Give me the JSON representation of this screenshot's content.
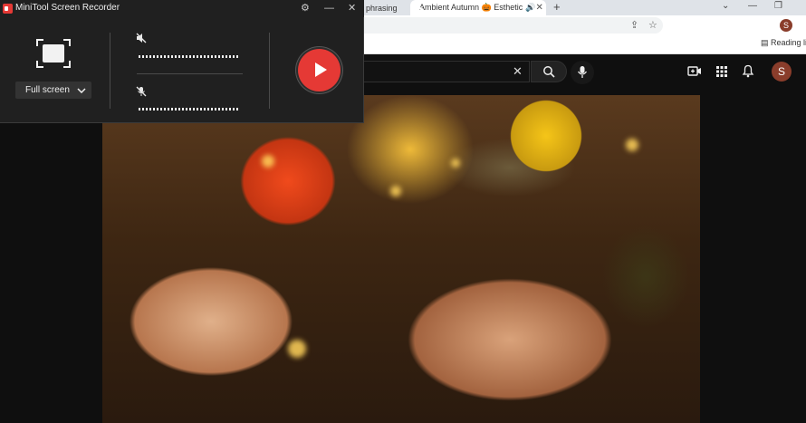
{
  "browser": {
    "tabs": [
      {
        "label": "phrasing"
      },
      {
        "label": "Ambient Autumn 🎃 Esthetic"
      }
    ],
    "new_tab": "+",
    "window_controls": {
      "minimize": "—",
      "restore": "❐",
      "close": "✕"
    },
    "bookmarks": {
      "reading_list": "Reading list"
    },
    "profile_initial": "S"
  },
  "youtube": {
    "search_clear": "✕",
    "avatar_initial": "S"
  },
  "recorder": {
    "title": "MiniTool Screen Recorder",
    "capture_mode": "Full screen",
    "controls": {
      "settings": "⚙",
      "minimize": "—",
      "close": "✕"
    },
    "system_audio": "muted",
    "microphone": "muted"
  },
  "icons": {
    "accent": "#e53935",
    "record_button": "#e53935"
  }
}
